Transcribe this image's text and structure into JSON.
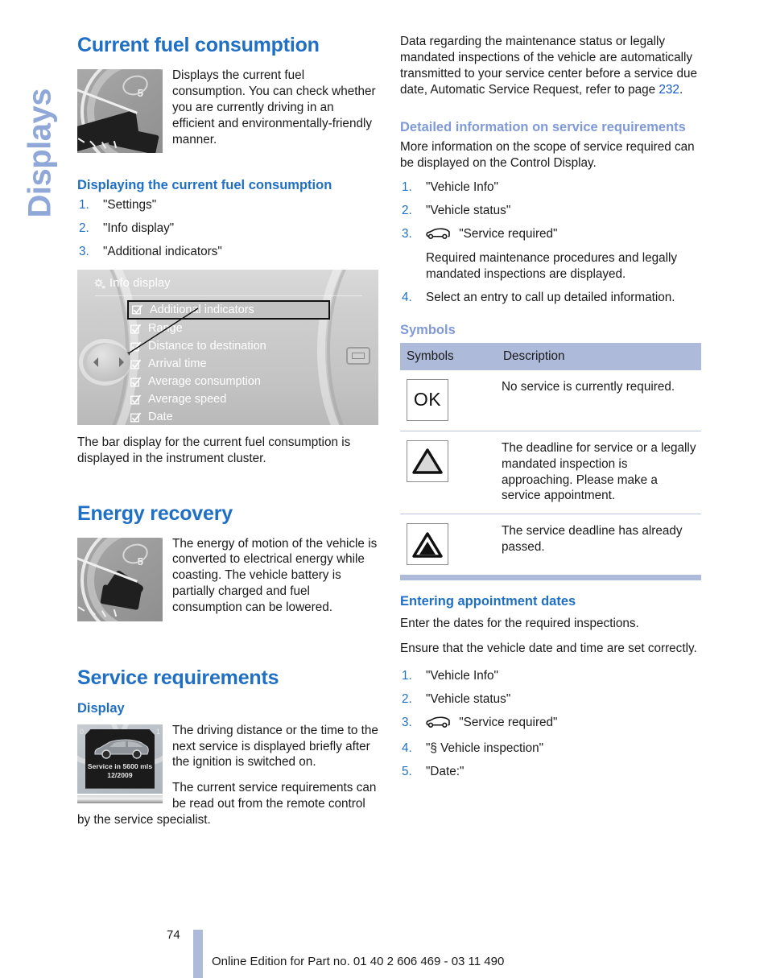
{
  "side_tab": {
    "label": "Displays"
  },
  "left_column": {
    "heading_current_fuel": "Current fuel consumption",
    "intro_text": "Displays the current fuel consumption. You can check whether you are currently driving in an efficient and environmentally-friendly manner.",
    "gauge_image_1": {
      "name": "fuel-consumption-gauge",
      "tick_label": "5"
    },
    "subheading_displaying": "Displaying the current fuel consumption",
    "steps": [
      {
        "num": "1.",
        "text": "\"Settings\""
      },
      {
        "num": "2.",
        "text": "\"Info display\""
      },
      {
        "num": "3.",
        "text": "\"Additional indicators\""
      }
    ],
    "control_display": {
      "title": "Info display",
      "menu_items": [
        {
          "label": "Additional indicators",
          "checked": true,
          "selected": true
        },
        {
          "label": "Range",
          "checked": true,
          "selected": false
        },
        {
          "label": "Distance to destination",
          "checked": true,
          "selected": false
        },
        {
          "label": "Arrival time",
          "checked": true,
          "selected": false
        },
        {
          "label": "Average consumption",
          "checked": true,
          "selected": false
        },
        {
          "label": "Average speed",
          "checked": true,
          "selected": false
        },
        {
          "label": "Date",
          "checked": true,
          "selected": false
        }
      ]
    },
    "after_display_text": "The bar display for the current fuel consumption is displayed in the instrument cluster.",
    "heading_energy_recovery": "Energy recovery",
    "energy_recovery_text": "The energy of motion of the vehicle is converted to electrical energy while coasting. The vehicle battery is partially charged and fuel consumption can be lowered.",
    "gauge_image_2": {
      "name": "energy-recovery-gauge",
      "tick_label": "5"
    },
    "heading_service_requirements": "Service requirements",
    "subheading_display": "Display",
    "service_display_image": {
      "name": "service-cluster-display",
      "line1": "Service in 5600 mls",
      "line2": "12/2009",
      "left_digit": "0",
      "right_digit": "1"
    },
    "service_display_text": "The driving distance or the time to the next service is displayed briefly after the ignition is switched on.",
    "service_remote_text": "The current service requirements can be read out from the remote control by the service specialist."
  },
  "right_column": {
    "intro_text_a": "Data regarding the maintenance status or legally mandated inspections of the vehicle are automatically transmitted to your service center before a service due date, Automatic Service Request, refer to page ",
    "intro_page_ref": "232",
    "intro_text_b": ".",
    "subheading_detailed": "Detailed information on service requirements",
    "detailed_text": "More information on the scope of service required can be displayed on the Control Display.",
    "detailed_steps": [
      {
        "num": "1.",
        "text": "\"Vehicle Info\"",
        "icon": null,
        "note": null
      },
      {
        "num": "2.",
        "text": "\"Vehicle status\"",
        "icon": null,
        "note": null
      },
      {
        "num": "3.",
        "text": "\"Service required\"",
        "icon": "car-icon",
        "note": "Required maintenance procedures and legally mandated inspections are displayed."
      },
      {
        "num": "4.",
        "text": "Select an entry to call up detailed information.",
        "icon": null,
        "note": null
      }
    ],
    "subheading_symbols": "Symbols",
    "symbols_table": {
      "headers": [
        "Symbols",
        "Description"
      ],
      "rows": [
        {
          "symbol": "OK",
          "symbol_name": "ok-symbol",
          "description": "No service is currently required."
        },
        {
          "symbol": "",
          "symbol_name": "warning-triangle-outline-symbol",
          "description": "The deadline for service or a legally mandated inspection is approaching. Please make a service appointment."
        },
        {
          "symbol": "",
          "symbol_name": "warning-triangle-filled-symbol",
          "description": "The service deadline has already passed."
        }
      ]
    },
    "subheading_entering_dates": "Entering appointment dates",
    "entering_text_1": "Enter the dates for the required inspections.",
    "entering_text_2": "Ensure that the vehicle date and time are set correctly.",
    "entering_steps": [
      {
        "num": "1.",
        "text": "\"Vehicle Info\"",
        "icon": null
      },
      {
        "num": "2.",
        "text": "\"Vehicle status\"",
        "icon": null
      },
      {
        "num": "3.",
        "text": "\"Service required\"",
        "icon": "car-icon"
      },
      {
        "num": "4.",
        "text": "\"§ Vehicle inspection\"",
        "icon": null
      },
      {
        "num": "5.",
        "text": "\"Date:\"",
        "icon": null
      }
    ]
  },
  "footer": {
    "page_number": "74",
    "edition_text": "Online Edition for Part no. 01 40 2 606 469 - 03 11 490"
  },
  "colors": {
    "heading_blue": "#1f6fc4",
    "light_blue": "#8fa8d8",
    "table_header": "#aebada",
    "link_blue": "#1558c8"
  }
}
